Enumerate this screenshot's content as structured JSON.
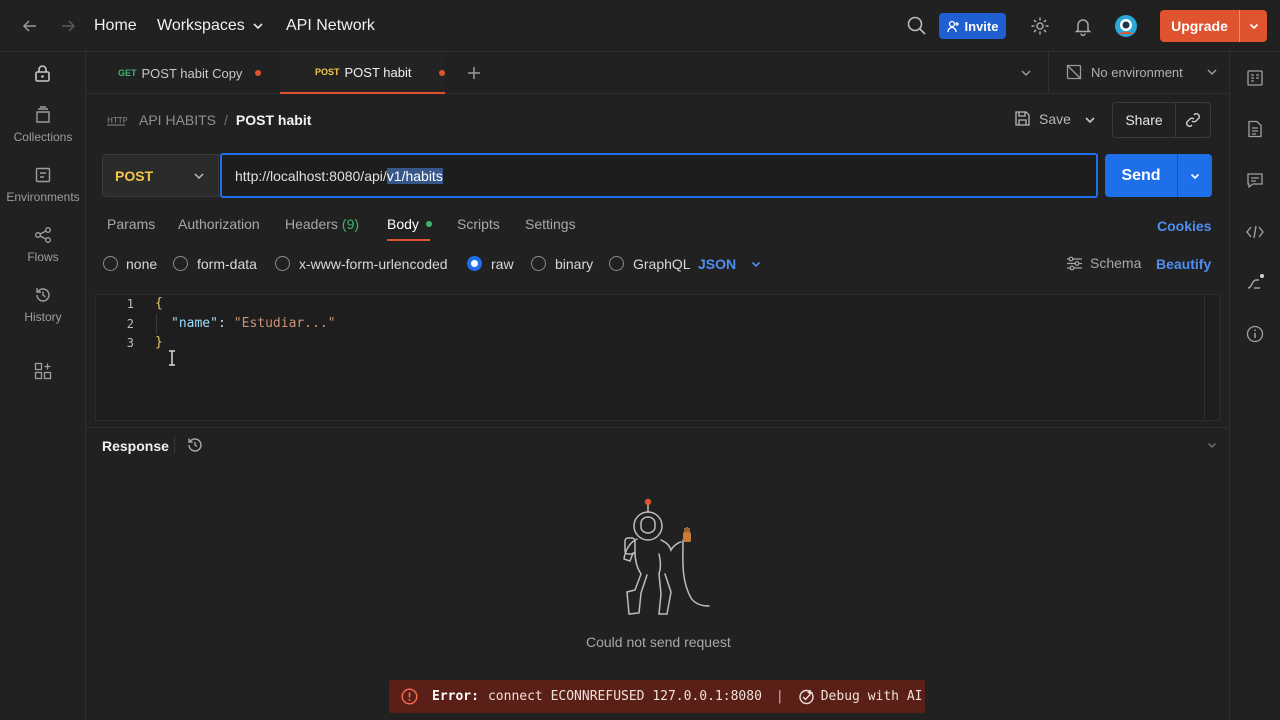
{
  "topbar": {
    "nav": [
      "Home",
      "Workspaces",
      "API Network"
    ],
    "invite_label": "Invite",
    "upgrade_label": "Upgrade"
  },
  "sidebar": {
    "items": [
      {
        "label": "Collections",
        "icon": "collections-icon"
      },
      {
        "label": "Environments",
        "icon": "environments-icon"
      },
      {
        "label": "Flows",
        "icon": "flows-icon"
      },
      {
        "label": "History",
        "icon": "history-icon"
      }
    ]
  },
  "tabs": [
    {
      "method": "GET",
      "name": "POST habit Copy",
      "modified": true
    },
    {
      "method": "POST",
      "name": "POST habit",
      "modified": true,
      "active": true
    }
  ],
  "environment": "No environment",
  "breadcrumb": {
    "collection": "API HABITS",
    "separator": "/",
    "request": "POST habit"
  },
  "actions": {
    "save": "Save",
    "share": "Share"
  },
  "request": {
    "method": "POST",
    "url_prefix": "http://localhost:8080/api/",
    "url_selected": "v1/habits",
    "send": "Send"
  },
  "request_tabs": {
    "params": "Params",
    "authorization": "Authorization",
    "headers": "Headers",
    "headers_count": "(9)",
    "body": "Body",
    "scripts": "Scripts",
    "settings": "Settings",
    "cookies": "Cookies"
  },
  "body_types": [
    "none",
    "form-data",
    "x-www-form-urlencoded",
    "raw",
    "binary",
    "GraphQL"
  ],
  "body_selected": "raw",
  "body_format": "JSON",
  "schema": "Schema",
  "beautify": "Beautify",
  "editor": {
    "line_numbers": [
      "1",
      "2",
      "3"
    ],
    "open_brace": "{",
    "key": "\"name\"",
    "colon": ":",
    "value": "\"Estudiar...\"",
    "close_brace": "}"
  },
  "response": {
    "title": "Response",
    "empty_message": "Could not send request",
    "error_label": "Error:",
    "error_message": "connect ECONNREFUSED 127.0.0.1:8080",
    "error_sep": "|",
    "debug_label": "Debug with AI"
  },
  "colors": {
    "accent": "#1f6feb",
    "upgrade": "#e0532f",
    "method_post": "#f3c74b",
    "method_get": "#41b36f",
    "error_bg": "#5a1f16",
    "json_key": "#9cdcfe",
    "json_string": "#ce9178"
  }
}
